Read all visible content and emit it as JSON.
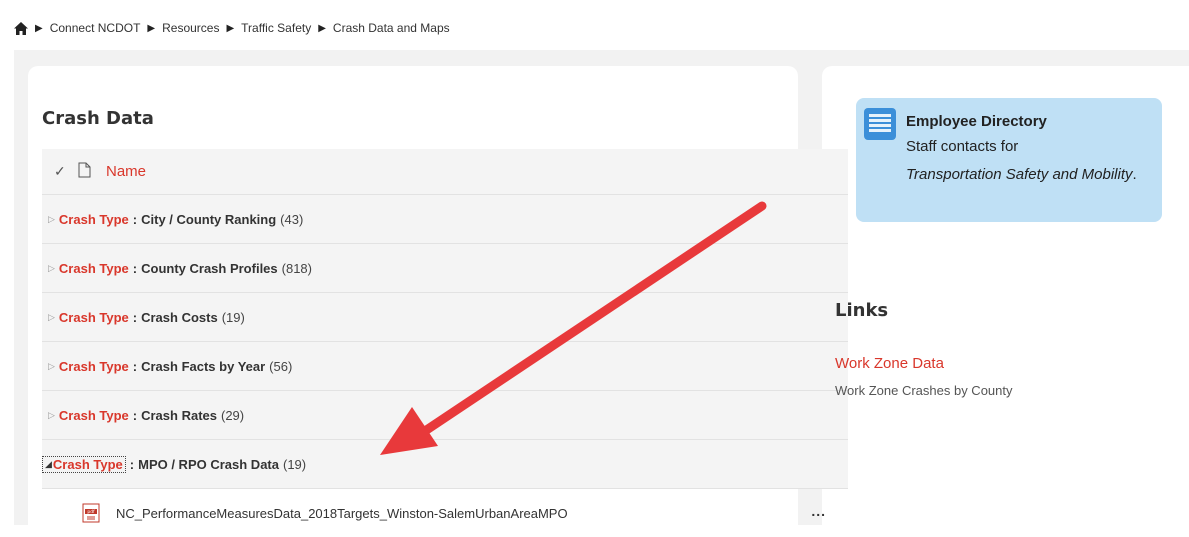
{
  "breadcrumb": {
    "items": [
      "Connect NCDOT",
      "Resources",
      "Traffic Safety",
      "Crash Data and Maps"
    ]
  },
  "main": {
    "title": "Crash Data",
    "list_header": {
      "name_label": "Name"
    },
    "groups": [
      {
        "type_label": "Crash Type",
        "separator": ":",
        "name": "City / County Ranking",
        "count": "(43)"
      },
      {
        "type_label": "Crash Type",
        "separator": ":",
        "name": "County Crash Profiles",
        "count": "(818)"
      },
      {
        "type_label": "Crash Type",
        "separator": ":",
        "name": "Crash Costs",
        "count": "(19)"
      },
      {
        "type_label": "Crash Type",
        "separator": ":",
        "name": "Crash Facts by Year",
        "count": "(56)"
      },
      {
        "type_label": "Crash Type",
        "separator": ":",
        "name": "Crash Rates",
        "count": "(29)"
      },
      {
        "type_label": "Crash Type",
        "separator": ":",
        "name": "MPO / RPO Crash Data",
        "count": "(19)"
      }
    ],
    "files": [
      {
        "name": "NC_PerformanceMeasuresData_2018Targets_Winston-SalemUrbanAreaMPO",
        "more": "..."
      }
    ]
  },
  "sidebar": {
    "employee_directory": {
      "title": "Employee Directory",
      "line1": "Staff contacts for",
      "line2": "Transportation Safety and Mobility",
      "line2_suffix": "."
    },
    "links_title": "Links",
    "links": [
      {
        "label": "Work Zone Data",
        "description": "Work Zone Crashes by County"
      }
    ]
  },
  "colors": {
    "accent": "#d9372b",
    "arrow": "#e8393b",
    "info_box": "#bfe0f5"
  },
  "icons": [
    "home-icon",
    "checkmark-icon",
    "document-icon",
    "expand-triangle-icon",
    "collapse-triangle-icon",
    "pdf-icon",
    "list-icon"
  ]
}
